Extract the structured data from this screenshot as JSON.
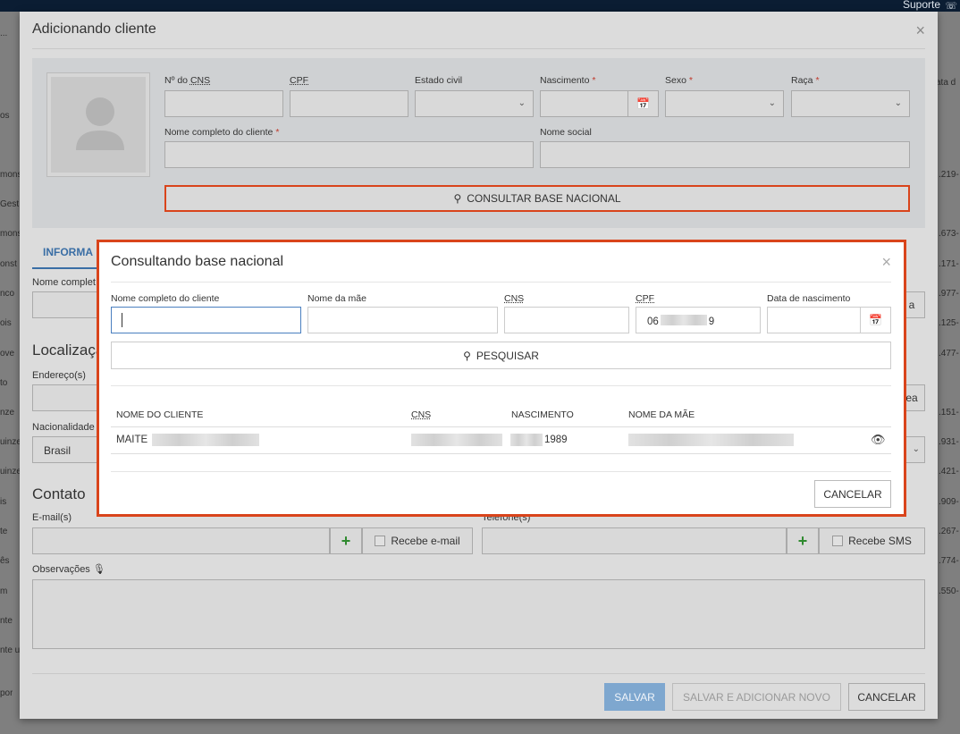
{
  "topbar": {
    "support_label": "Suporte",
    "support_icon": "headset-icon"
  },
  "background": {
    "left_fragments": [
      "...",
      "os",
      "mons",
      "Gest",
      "mons",
      "onst",
      "nco",
      "ois",
      "ove",
      "to",
      "nze",
      "uinze",
      "uinze",
      "is",
      "te",
      "ês",
      "m",
      "nte",
      "nte u",
      "por"
    ],
    "right_fragments": [
      "ata d",
      ".219-",
      ".673-",
      ".171-",
      ".977-",
      ".125-",
      ".477-",
      ".151-",
      ".931-",
      ".421-",
      ".909-",
      ".267-",
      ".774-",
      ".550-"
    ]
  },
  "main_modal": {
    "title": "Adicionando cliente",
    "close_glyph": "×",
    "fields": {
      "cns_label": "Nº do ",
      "cns_abbr": "CNS",
      "cpf_label": "CPF",
      "estado_civil_label": "Estado civil",
      "nascimento_label": "Nascimento",
      "sexo_label": "Sexo",
      "raca_label": "Raça",
      "nome_completo_label": "Nome completo do cliente",
      "nome_social_label": "Nome social",
      "required_mark": "*"
    },
    "consult_button": "CONSULTAR BASE NACIONAL",
    "tab_info": "INFORMA",
    "nome_completo_label2": "Nome complet",
    "right_button_fragment": "a",
    "localizacao_title": "Localizaçã",
    "enderecos_label": "Endereço(s)",
    "right_button_fragment2": "ea",
    "nacionalidade_label": "Nacionalidade",
    "nacionalidade_value": "Brasil",
    "contato_title": "Contato",
    "email_label": "E-mail(s)",
    "telefone_label": "Telefone(s)",
    "recebe_email": "Recebe e-mail",
    "recebe_sms": "Recebe SMS",
    "plus_glyph": "+",
    "observacoes_label": "Observações",
    "save_button": "SALVAR",
    "save_add_button": "SALVAR E ADICIONAR NOVO",
    "cancel_button": "CANCELAR"
  },
  "dialog": {
    "title": "Consultando base nacional",
    "close_glyph": "×",
    "fields": {
      "nome_label": "Nome completo do cliente",
      "mae_label": "Nome da mãe",
      "cns_label": "CNS",
      "cpf_label": "CPF",
      "cpf_value_start": "06",
      "cpf_value_end": "9",
      "nascimento_label": "Data de nascimento"
    },
    "search_button": "PESQUISAR",
    "table": {
      "headers": [
        "NOME DO CLIENTE",
        "CNS",
        "NASCIMENTO",
        "NOME DA MÃE"
      ],
      "rows": [
        {
          "name_prefix": "MAITE",
          "birth_suffix": "1989"
        }
      ]
    },
    "cancel_button": "CANCELAR"
  },
  "colors": {
    "accent_red": "#d9441b",
    "link_blue": "#3a6ea5",
    "plus_green": "#2f8a2f"
  }
}
